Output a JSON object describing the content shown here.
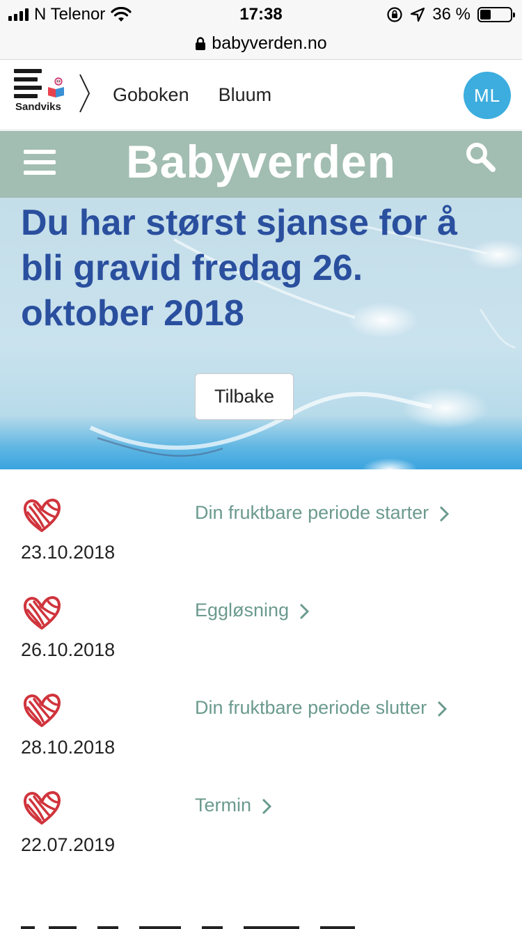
{
  "status_bar": {
    "carrier": "N Telenor",
    "time": "17:38",
    "battery_text": "36 %",
    "battery_level": 0.36,
    "icons": [
      "signal-icon",
      "wifi-icon",
      "rotation-lock-icon",
      "location-icon",
      "battery-icon"
    ]
  },
  "url_bar": {
    "url": "babyverden.no",
    "icon": "lock-icon"
  },
  "sandviks_header": {
    "logo_label": "Sandviks",
    "nav": [
      "Goboken",
      "Bluum"
    ],
    "avatar_initials": "ML",
    "avatar_color": "#3cadde"
  },
  "brand_bar": {
    "title": "Babyverden",
    "background": "#a2bdb2"
  },
  "hero": {
    "title": "Du har størst sjanse for å bli gravid fredag 26. oktober 2018",
    "back_button": "Tilbake",
    "title_color": "#2a4f9e"
  },
  "dates": [
    {
      "date": "23.10.2018",
      "label": "Din fruktbare periode starter"
    },
    {
      "date": "26.10.2018",
      "label": "Eggløsning"
    },
    {
      "date": "28.10.2018",
      "label": "Din fruktbare periode slutter"
    },
    {
      "date": "22.07.2019",
      "label": "Termin"
    }
  ],
  "colors": {
    "link": "#6b9a8e",
    "heart": "#d0343c"
  }
}
